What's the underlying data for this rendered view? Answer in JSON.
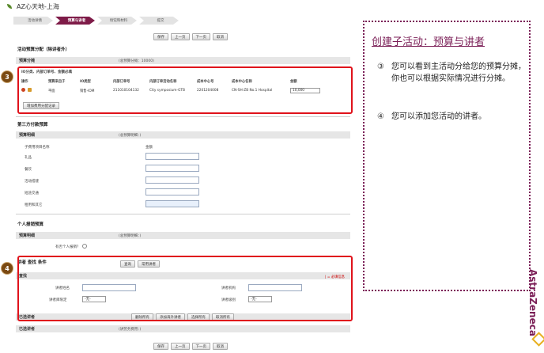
{
  "app": {
    "title": "AZ心天地-上海"
  },
  "steps": [
    "活动详情",
    "预算与讲者",
    "场馆和材料",
    "提交"
  ],
  "nav_buttons": {
    "save": "保存",
    "prev": "上一页",
    "next": "下一页",
    "cancel": "取消"
  },
  "sections": {
    "budget_alloc_title": "活动预算分配（除讲者外）",
    "budget_alloc_bar": "预算分摊",
    "budget_alloc_sub": "(总预算分摊：10000)",
    "io_title": "IO分类、内部订单号、金额必填",
    "third_party_title": "第三方付款预算",
    "third_party_bar": "预算明细",
    "third_party_sub": "(总预算明细：)",
    "personal_title": "个人报销预算",
    "personal_bar": "预算明细",
    "personal_sub": "(总预算明细：)",
    "speaker_search_title": "讲者 查找 条件",
    "speaker_find_bar": "查找",
    "selected_bar": "已选讲者",
    "selected_list_bar": "已选讲者",
    "selected_list_sub": "(讲劳务费用：)"
  },
  "alloc_table": {
    "headers": [
      "操作",
      "预算来自于",
      "IO类型",
      "内部订单号",
      "内部订单活动名称",
      "成本中心号",
      "成本中心名称",
      "金额"
    ],
    "row": [
      "",
      "平面",
      "销售-IOM",
      "211010104132",
      "City symposium-GTB",
      "2201204008",
      "CN-SH-ZB No.1 Hospital",
      "10,000"
    ]
  },
  "add_record_label": "增加费用分配记录",
  "third_party_fields": {
    "header_name": "子费用项目名称",
    "header_amount": "金额",
    "items": [
      "礼品",
      "餐饮",
      "活动搭建",
      "短途交通",
      "租用和其它"
    ]
  },
  "personal_fields": {
    "question": "有否个人报销？"
  },
  "speaker_search": {
    "search_btn": "查询",
    "common_btn": "常用讲者",
    "name_label": "讲者姓名",
    "org_label": "讲者机构",
    "scope_label": "讲者库限定",
    "level_label": "讲者级别",
    "scope_value": "-无-",
    "level_value": "-无-",
    "required_note": "| = 必填信息"
  },
  "selected_actions": [
    "删除所有",
    "添加海外讲者",
    "选择所有",
    "取消所有"
  ],
  "side": {
    "title": "创建子活动：预算与讲者",
    "tip3_mark": "③",
    "tip3_text": "您可以看到主活动分给您的预算分摊，你也可以根据实际情况进行分摊。",
    "tip4_mark": "④",
    "tip4_text": "您可以添加您活动的讲者。"
  },
  "callouts": {
    "c3": "3",
    "c4": "4"
  },
  "brand": {
    "name": "AstraZeneca"
  }
}
